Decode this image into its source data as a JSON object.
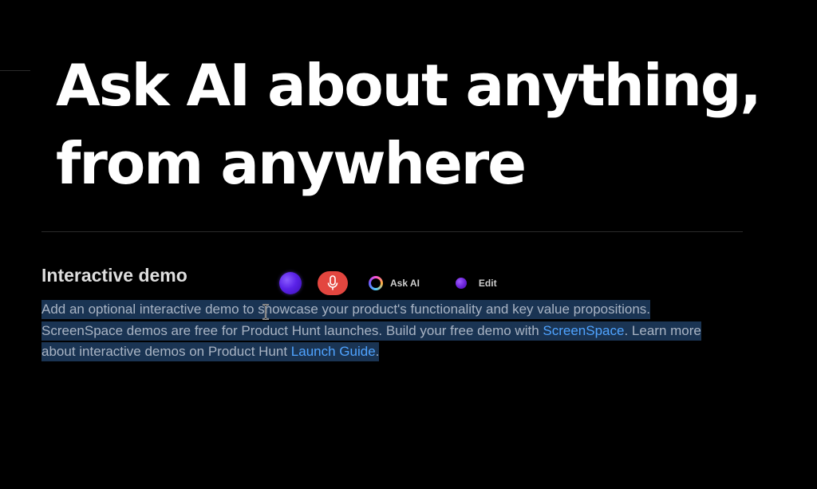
{
  "headline": {
    "line1": "Ask AI about anything,",
    "line2": "from anywhere"
  },
  "section": {
    "title": "Interactive demo"
  },
  "toolbar": {
    "orb_icon": "assistant-orb-icon",
    "mic_icon": "microphone-icon",
    "mic_color": "#e3463f",
    "ask_ai_label": "Ask AI",
    "ask_ai_icon": "gradient-ring-icon",
    "edit_label": "Edit",
    "edit_icon": "purple-dot-icon"
  },
  "description": {
    "line1": "Add an optional interactive demo to showcase your product's functionality and key value propositions.",
    "line2_prefix": "ScreenSpace demos are free for Product Hunt launches. Build your free demo with ",
    "line2_link": "ScreenSpace",
    "line2_suffix": ". Learn more",
    "line3_prefix": "about interactive demos on Product Hunt ",
    "line3_link": "Launch Guide",
    "line3_suffix": "."
  },
  "colors": {
    "background": "#000000",
    "selection": "#1a3453",
    "link": "#4fa3ff",
    "body_text": "#a9b4c4"
  }
}
